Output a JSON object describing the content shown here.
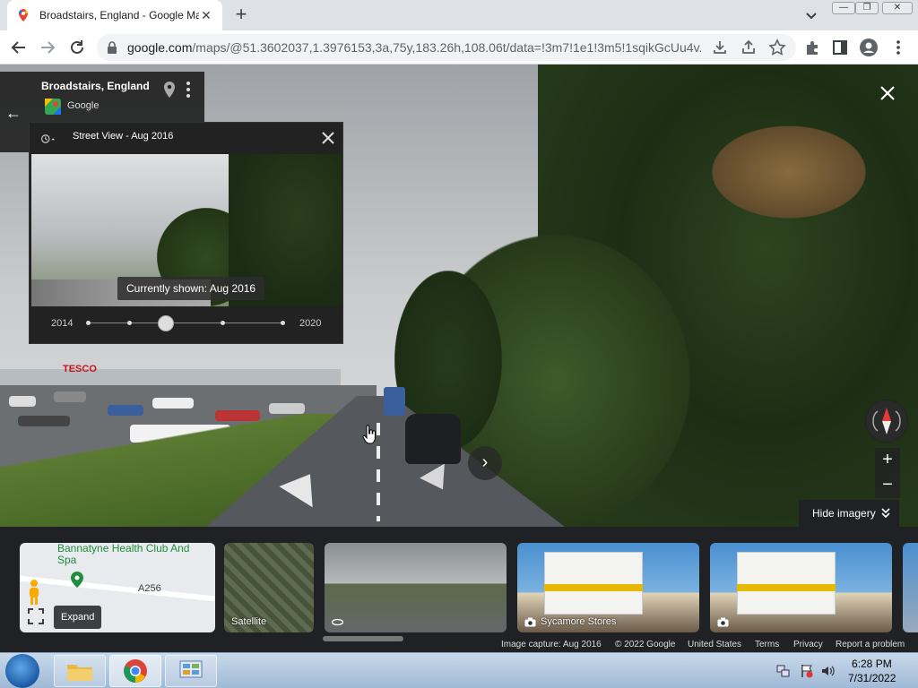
{
  "browser": {
    "tab_title": "Broadstairs, England - Google Ma",
    "url_host": "google.com",
    "url_path": "/maps/@51.3602037,1.3976153,3a,75y,183.26h,108.06t/data=!3m7!1e1!3m5!1sqikGcUu4v..."
  },
  "place": {
    "name": "Broadstairs, England",
    "source": "Google"
  },
  "time_machine": {
    "title": "Street View - Aug 2016",
    "current": "Currently shown: Aug 2016",
    "year_start": "2014",
    "year_end": "2020",
    "selected_fraction": 0.4
  },
  "controls": {
    "zoom_in": "+",
    "zoom_out": "−",
    "hide_imagery": "Hide imagery",
    "next": "›"
  },
  "mini_map": {
    "poi_label": "Bannatyne Health Club And Spa",
    "road_label": "A256",
    "expand_tooltip": "Expand"
  },
  "thumbnails": [
    {
      "label": "Satellite"
    },
    {
      "label": ""
    },
    {
      "label": "Sycamore Stores"
    },
    {
      "label": ""
    }
  ],
  "footer": {
    "capture": "Image capture: Aug 2016",
    "copyright": "© 2022 Google",
    "region": "United States",
    "terms": "Terms",
    "privacy": "Privacy",
    "report": "Report a problem"
  },
  "taskbar": {
    "time": "6:28 PM",
    "date": "7/31/2022"
  },
  "colors": {
    "chrome_tabstrip": "#dee1e6",
    "panel_dark": "#222222",
    "maps_pin_green": "#1e8e3e"
  }
}
